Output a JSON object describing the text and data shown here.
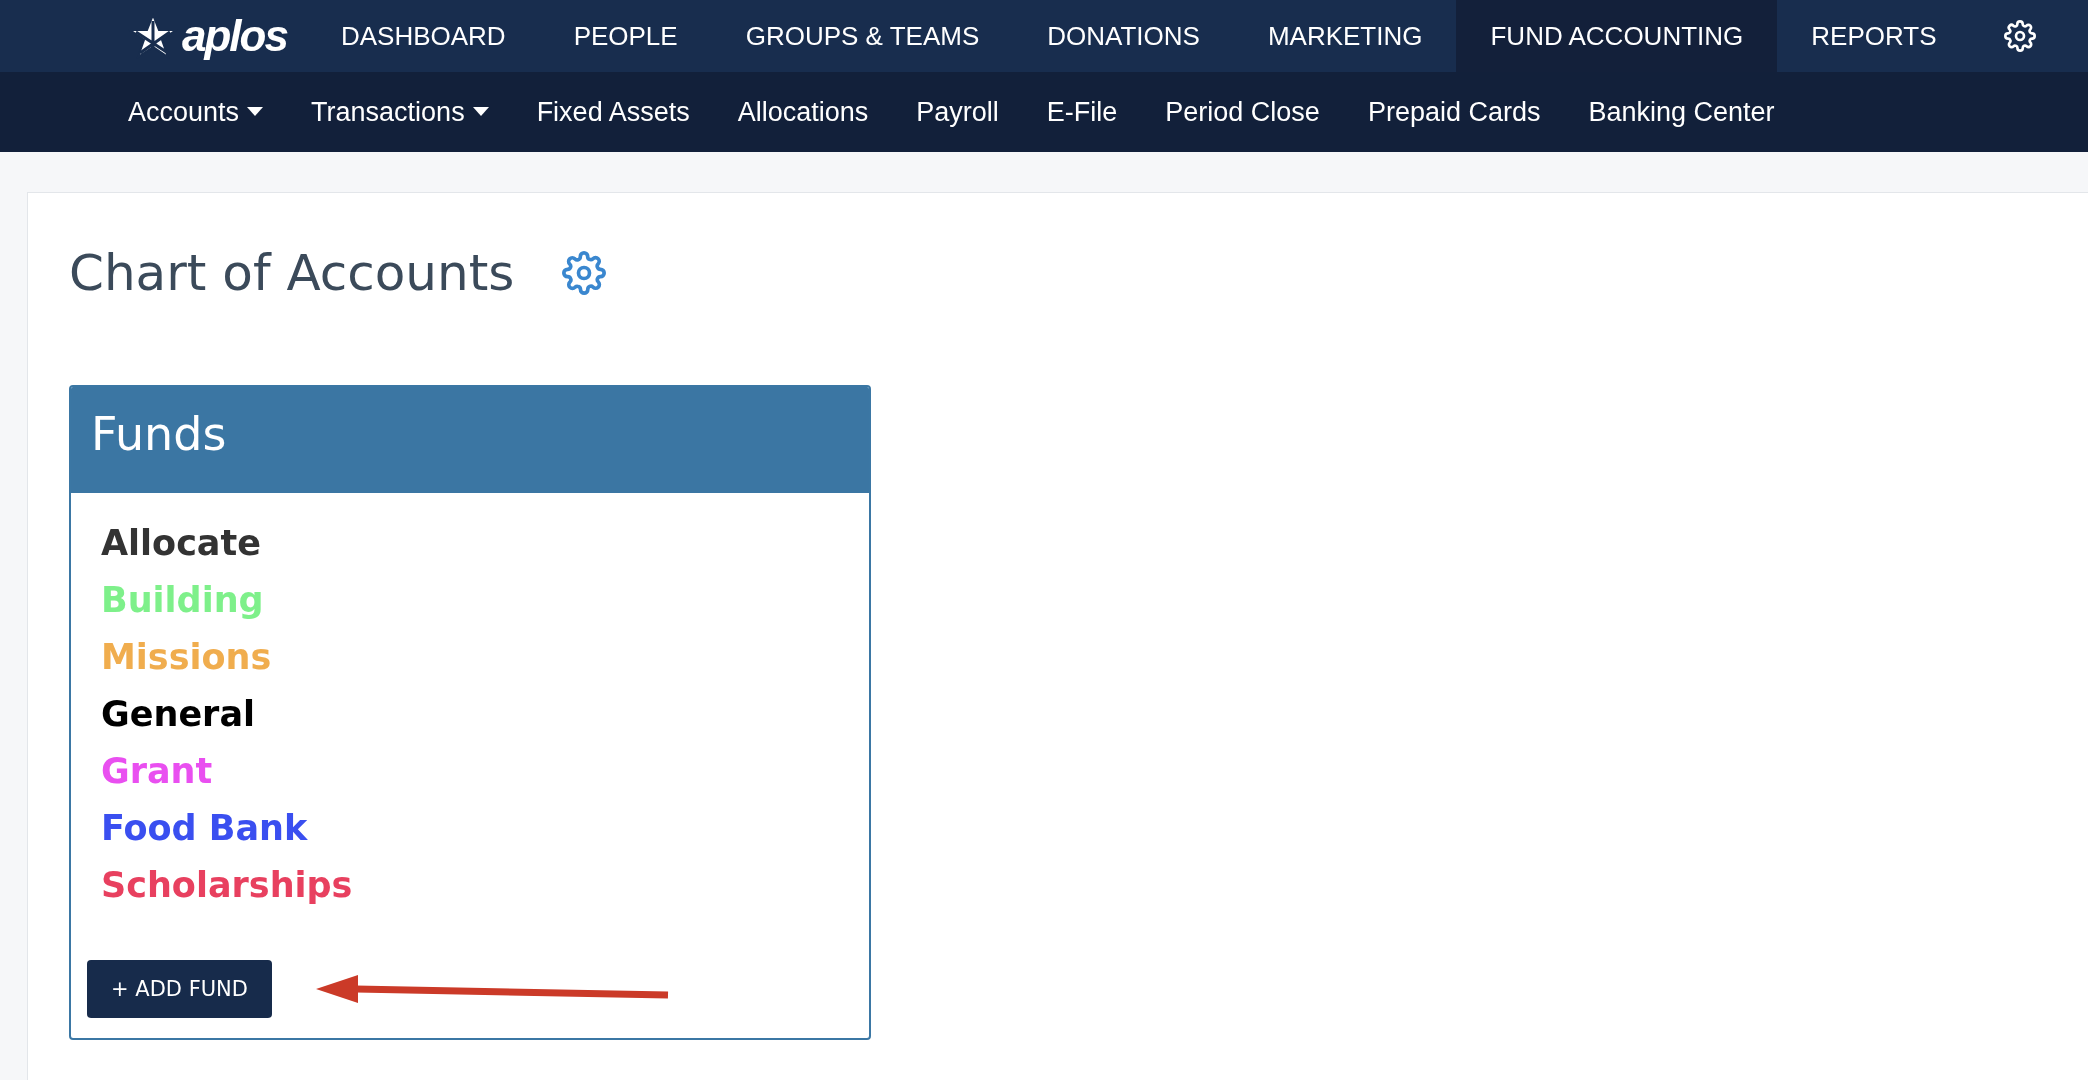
{
  "top_nav": {
    "logo": "aplos",
    "items": [
      {
        "label": "DASHBOARD",
        "selected": false
      },
      {
        "label": "PEOPLE",
        "selected": false
      },
      {
        "label": "GROUPS & TEAMS",
        "selected": false
      },
      {
        "label": "DONATIONS",
        "selected": false
      },
      {
        "label": "MARKETING",
        "selected": false
      },
      {
        "label": "FUND ACCOUNTING",
        "selected": true
      },
      {
        "label": "REPORTS",
        "selected": false
      }
    ]
  },
  "sub_nav": [
    {
      "label": "Accounts",
      "dropdown": true
    },
    {
      "label": "Transactions",
      "dropdown": true
    },
    {
      "label": "Fixed Assets",
      "dropdown": false
    },
    {
      "label": "Allocations",
      "dropdown": false
    },
    {
      "label": "Payroll",
      "dropdown": false
    },
    {
      "label": "E-File",
      "dropdown": false
    },
    {
      "label": "Period Close",
      "dropdown": false
    },
    {
      "label": "Prepaid Cards",
      "dropdown": false
    },
    {
      "label": "Banking Center",
      "dropdown": false
    }
  ],
  "page": {
    "title": "Chart of Accounts"
  },
  "funds_panel": {
    "title": "Funds",
    "funds": [
      {
        "name": "Allocate",
        "color": "#333333"
      },
      {
        "name": "Building",
        "color": "#7ef08a"
      },
      {
        "name": "Missions",
        "color": "#f0ad4e"
      },
      {
        "name": "General",
        "color": "#000000"
      },
      {
        "name": "Grant",
        "color": "#e94ff0"
      },
      {
        "name": "Food Bank",
        "color": "#3a4ff0"
      },
      {
        "name": "Scholarships",
        "color": "#e8405f"
      }
    ],
    "button": "+ ADD FUND"
  }
}
